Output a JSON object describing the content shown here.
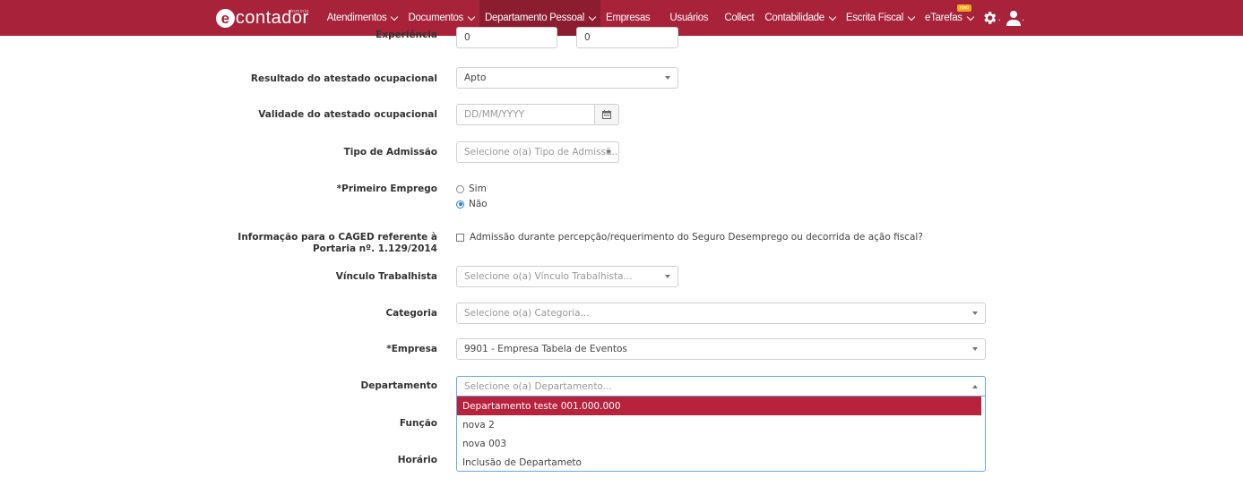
{
  "navbar": {
    "brand": {
      "logo_letter": "e",
      "name": "contador",
      "sub": "dominio"
    },
    "items": [
      {
        "label": "Atendimentos",
        "has_caret": true
      },
      {
        "label": "Documentos",
        "has_caret": true
      },
      {
        "label": "Departamento Pessoal",
        "has_caret": true
      },
      {
        "label": "Empresas",
        "has_caret": false
      },
      {
        "label": "Usuários",
        "has_caret": false
      },
      {
        "label": "Collect",
        "has_caret": false
      },
      {
        "label": "Contabilidade",
        "has_caret": true
      },
      {
        "label": "Escrita Fiscal",
        "has_caret": true
      },
      {
        "label": "eTarefas",
        "has_caret": true
      }
    ],
    "etarefas_badge": "novo",
    "icons": [
      "gear-icon",
      "user-icon"
    ],
    "color": "#a8223a"
  },
  "form": {
    "experiencia": {
      "label": "Experiência",
      "value1": "0",
      "value2": "0"
    },
    "resultado": {
      "label": "Resultado do atestado ocupacional",
      "value": "Apto"
    },
    "validade": {
      "label": "Validade do atestado ocupacional",
      "placeholder": "DD/MM/YYYY"
    },
    "tipo_admissao": {
      "label": "Tipo de Admissão",
      "placeholder": "Selecione o(a) Tipo de Admissã..."
    },
    "primeiro_emprego": {
      "label": "*Primeiro Emprego",
      "options": [
        "Sim",
        "Não"
      ],
      "selected": "Não"
    },
    "caged": {
      "label_line1": "Informação para o CAGED referente à",
      "label_line2": "Portaria nº. 1.129/2014",
      "checkbox_label": "Admissão durante percepção/requerimento do Seguro Desemprego ou decorrida de ação fiscal?",
      "checked": false
    },
    "vinculo": {
      "label": "Vínculo Trabalhista",
      "placeholder": "Selecione o(a) Vínculo Trabalhista..."
    },
    "categoria": {
      "label": "Categoria",
      "placeholder": "Selecione o(a) Categoria..."
    },
    "empresa": {
      "label": "*Empresa",
      "value": "9901 - Empresa Tabela de Eventos"
    },
    "departamento": {
      "label": "Departamento",
      "placeholder": "Selecione o(a) Departamento...",
      "options": [
        "Departamento teste 001.000.000",
        "nova 2",
        "nova 003",
        "Inclusão de Departameto"
      ],
      "highlighted_index": 0
    },
    "funcao": {
      "label": "Função"
    },
    "horario": {
      "label": "Horário"
    }
  }
}
